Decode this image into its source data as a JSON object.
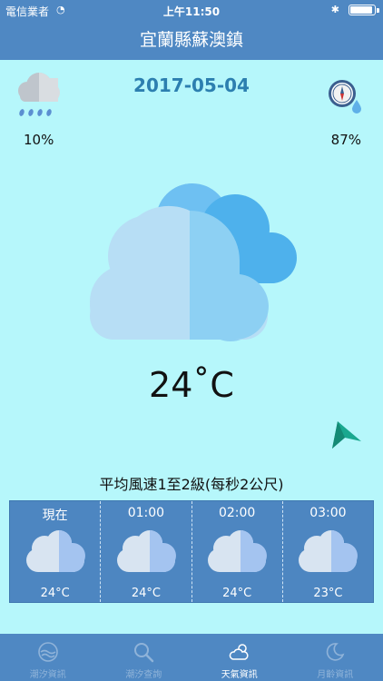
{
  "status_bar": {
    "carrier": "電信業者",
    "time": "上午11:50"
  },
  "header": {
    "title": "宜蘭縣蘇澳鎮"
  },
  "weather": {
    "date": "2017-05-04",
    "rain_chance": "10%",
    "humidity": "87%",
    "temperature": "24˚C",
    "wind": "平均風速1至2級(每秒2公尺)",
    "wind_direction_icon": "arrow-icon",
    "condition_icon": "cloudy-icon"
  },
  "forecast": [
    {
      "time": "現在",
      "temp": "24°C"
    },
    {
      "time": "01:00",
      "temp": "24°C"
    },
    {
      "time": "02:00",
      "temp": "24°C"
    },
    {
      "time": "03:00",
      "temp": "23°C"
    }
  ],
  "tabs": [
    {
      "label": "潮汐資訊",
      "icon": "tide-icon",
      "active": false
    },
    {
      "label": "潮汐查詢",
      "icon": "search-icon",
      "active": false
    },
    {
      "label": "天氣資訊",
      "icon": "weather-icon",
      "active": true
    },
    {
      "label": "月齡資訊",
      "icon": "moon-icon",
      "active": false
    }
  ],
  "colors": {
    "bar": "#4f88c3",
    "background": "#b6f7fb",
    "date": "#2c7fb0",
    "arrow": "#1aa88f"
  }
}
